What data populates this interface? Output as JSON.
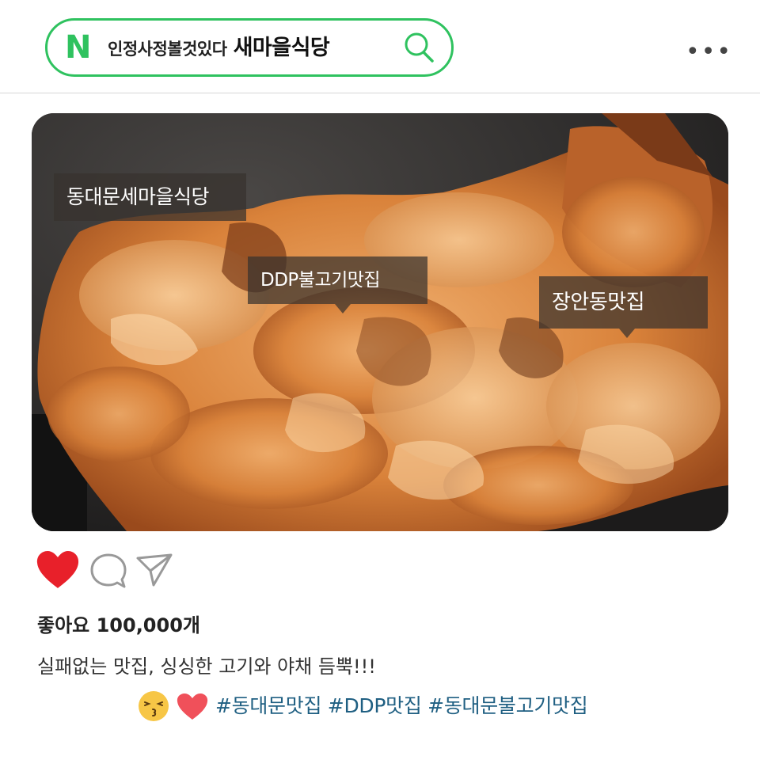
{
  "search": {
    "brand_letter": "N",
    "query_prefix": "인정사정볼것있다",
    "query_main": "새마을식당"
  },
  "header": {
    "more_label": "•••"
  },
  "photo": {
    "tags": [
      "동대문세마을식당",
      "DDP불고기맛집",
      "장안동맛집"
    ]
  },
  "post": {
    "likes_text": "좋아요 100,000개",
    "caption": "실패없는 맛집, 싱싱한 고기와 야채 듬뿍!!!",
    "hashtags": "#동대문맛집 #DDP맛집 #동대문불고기맛집"
  },
  "colors": {
    "naver_green": "#2fc25f",
    "heart_red": "#e8202a",
    "small_heart": "#f0505a",
    "hashtag_blue": "#1f5f82"
  },
  "icons": [
    "search-icon",
    "more-icon",
    "heart-icon",
    "comment-icon",
    "share-icon",
    "kiss-emoji-icon",
    "small-heart-icon"
  ]
}
